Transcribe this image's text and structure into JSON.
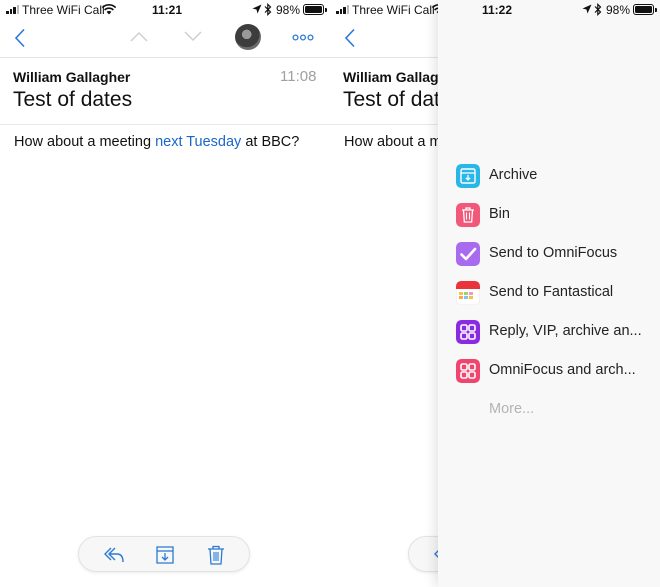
{
  "status_left": {
    "carrier": "Three WiFi Call",
    "time": "11:21",
    "battery": "98%"
  },
  "status_right": {
    "carrier": "Three WiFi Call",
    "time": "11:22",
    "battery": "98%"
  },
  "email": {
    "sender": "William Gallagher",
    "time": "11:08",
    "subject": "Test of dates",
    "body_before": "How about a meeting ",
    "body_link": "next Tuesday",
    "body_after": " at BBC?"
  },
  "email_partial": {
    "sender": "William Gallagh",
    "subject": "Test of date",
    "body": "How about a me"
  },
  "nav": {
    "icons": [
      "back-chevron-icon",
      "previous-message-icon",
      "next-message-icon",
      "avatar",
      "more-options-icon"
    ]
  },
  "toolbar": {
    "icons": [
      "reply-icon",
      "archive-icon",
      "trash-icon"
    ]
  },
  "actions": {
    "items": [
      {
        "label": "Archive",
        "icon": "archive-icon",
        "color": "#2ab7e8"
      },
      {
        "label": "Bin",
        "icon": "bin-icon",
        "color": "#f2587a"
      },
      {
        "label": "Send to OmniFocus",
        "icon": "checkmark-icon",
        "color": "#a86bf0"
      },
      {
        "label": "Send to Fantastical",
        "icon": "calendar-icon",
        "color": "#ffffff"
      },
      {
        "label": "Reply, VIP, archive an...",
        "icon": "grid-icon",
        "color": "#8a2be2"
      },
      {
        "label": "OmniFocus and arch...",
        "icon": "grid-icon",
        "color": "#f0456e"
      }
    ],
    "more_label": "More..."
  },
  "colors": {
    "accent": "#1b66c9",
    "nav_icon": "#2a7ad4",
    "muted": "#a0a0a0"
  }
}
